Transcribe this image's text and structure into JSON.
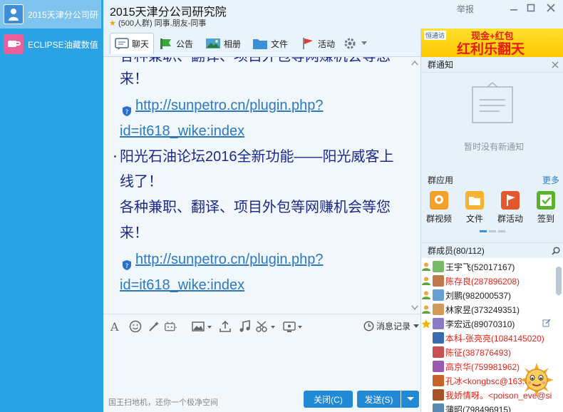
{
  "sessions": [
    {
      "name": "2015天津分公司研",
      "icon": "person-avatar-icon"
    },
    {
      "name": "ECLIPSE油藏数值",
      "icon": "cup-avatar-icon"
    }
  ],
  "header": {
    "title": "2015天津分公司研究院",
    "subtitle_star": "★",
    "subtitle": "(500人群) 同事.朋友-同事",
    "report_label": "举报"
  },
  "tabs": [
    {
      "label": "聊天",
      "icon": "chat-icon"
    },
    {
      "label": "公告",
      "icon": "announcement-icon"
    },
    {
      "label": "相册",
      "icon": "photo-album-icon"
    },
    {
      "label": "文件",
      "icon": "folder-icon"
    },
    {
      "label": "活动",
      "icon": "flag-icon"
    }
  ],
  "chat": {
    "partial_top": "各种兼职、翻译、项目外包等网赚机会等您",
    "line_lai": "来！",
    "link1": "http://sunpetro.cn/plugin.php?",
    "link2": "id=it618_wike:index",
    "headline1": "阳光石油论坛2016全新功能——阳光威客上",
    "headline2": "线了！",
    "body": "各种兼职、翻译、项目外包等网赚机会等您",
    "line_lai2": "来！",
    "link3": "http://sunpetro.cn/plugin.php?",
    "link4": "id=it618_wike:index"
  },
  "input": {
    "history_label": "消息记录",
    "ad_text": "国王扫地机，还你一个极净空间",
    "close_label": "关闭(C)",
    "send_label": "发送(S)"
  },
  "right": {
    "banner_top": "现金+红包",
    "banner_main": "红利乐翻天",
    "banner_brand": "恒通访",
    "notice_title": "群通知",
    "notice_empty": "暂时没有新通知",
    "apps_title": "群应用",
    "apps_more": "更多",
    "apps": [
      {
        "label": "群视频",
        "icon": "group-video-icon",
        "color": "#f2a12b"
      },
      {
        "label": "文件",
        "icon": "file-icon",
        "color": "#f6b332"
      },
      {
        "label": "群活动",
        "icon": "group-activity-icon",
        "color": "#e4572e"
      },
      {
        "label": "签到",
        "icon": "checkin-icon",
        "color": "#5ab22c"
      }
    ],
    "members_title": "群成员(80/112)",
    "members": [
      {
        "name": "王宇飞(52017167)",
        "color": "#222",
        "role": "member"
      },
      {
        "name": "陈存良(287896208)",
        "color": "#e0261a",
        "role": "member"
      },
      {
        "name": "刘鹏(982000537)",
        "color": "#222",
        "role": "member"
      },
      {
        "name": "林家昱(373249351)",
        "color": "#222",
        "role": "member"
      },
      {
        "name": "李宏远(89070310)",
        "color": "#222",
        "role": "owner"
      },
      {
        "name": "本科-张亮亮(1084145020)",
        "color": "#e0261a",
        "role": "none"
      },
      {
        "name": "陈征(387876493)",
        "color": "#e0261a",
        "role": "none"
      },
      {
        "name": "高京华(759981962)",
        "color": "#e0261a",
        "role": "none"
      },
      {
        "name": "孔冰<kongbsc@163.c",
        "color": "#e0261a",
        "role": "none"
      },
      {
        "name": "我娇情呀。<poison_eve@si",
        "color": "#e0261a",
        "role": "none"
      },
      {
        "name": "蒲昭(798496915)",
        "color": "#222",
        "role": "none"
      }
    ]
  },
  "colors": {
    "accent": "#2aa2e3",
    "chat_text": "#1b2a8a",
    "link": "#2b79c1",
    "send_button": "#2289d6"
  }
}
